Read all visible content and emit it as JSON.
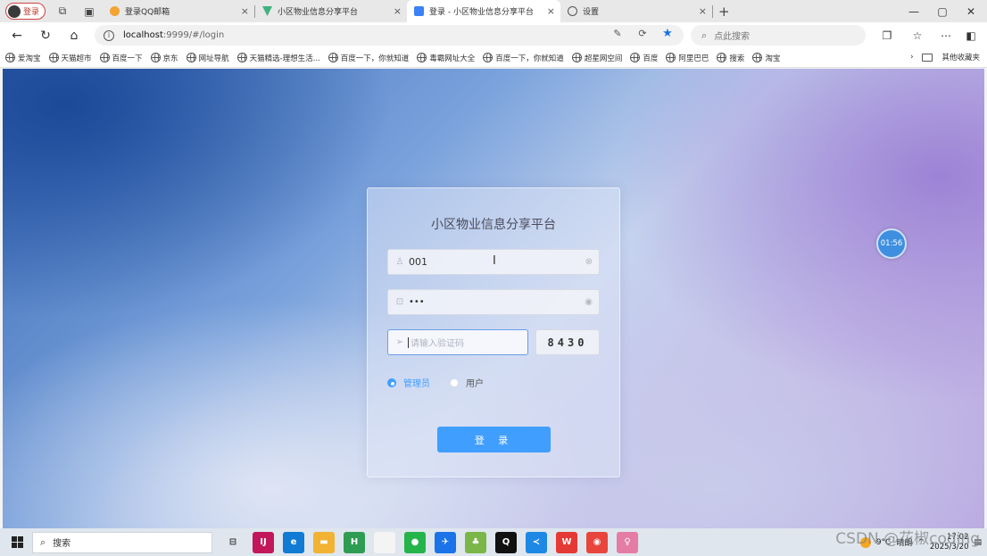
{
  "browser": {
    "profile_label": "登录",
    "tabs": [
      {
        "title": "登录QQ邮箱",
        "color": "#f2a533"
      },
      {
        "title": "小区物业信息分享平台",
        "color": "#3fb27f"
      },
      {
        "title": "登录 - 小区物业信息分享平台",
        "color": "#3c82f6"
      },
      {
        "title": "设置",
        "color": "#555555"
      }
    ],
    "address": {
      "host": "localhost",
      "rest": ":9999/#/login"
    },
    "search_placeholder": "点此搜索",
    "bookmarks": [
      "爱淘宝",
      "天猫超市",
      "百度一下",
      "京东",
      "网址导航",
      "天猫精选-理想生活...",
      "百度一下，你就知道",
      "毒霸网址大全",
      "百度一下，你就知道",
      "超星网空间",
      "百度",
      "阿里巴巴",
      "搜索",
      "淘宝"
    ],
    "other_bookmarks": "其他收藏夹"
  },
  "login": {
    "title": "小区物业信息分享平台",
    "username_value": "001",
    "password_value": "•••",
    "captcha_placeholder": "请输入验证码",
    "captcha_code": "8430",
    "roles": [
      {
        "label": "管理员",
        "selected": true
      },
      {
        "label": "用户",
        "selected": false
      }
    ],
    "submit_label": "登 录"
  },
  "timer_badge": "01:56",
  "taskbar": {
    "search_label": "搜索",
    "apps": [
      {
        "name": "task-view",
        "color": "#dfe6ee",
        "glyph": "⊟"
      },
      {
        "name": "idea",
        "color": "#c2185b",
        "glyph": "IJ"
      },
      {
        "name": "edge",
        "color": "#0f7bd4",
        "glyph": "e"
      },
      {
        "name": "explorer",
        "color": "#f2b233",
        "glyph": "▬"
      },
      {
        "name": "hbuilder",
        "color": "#2e9d53",
        "glyph": "H"
      },
      {
        "name": "notepad",
        "color": "#f4f4f4",
        "glyph": ""
      },
      {
        "name": "wechat",
        "color": "#25b44a",
        "glyph": "●"
      },
      {
        "name": "feishu",
        "color": "#1a73e8",
        "glyph": "✈"
      },
      {
        "name": "frog",
        "color": "#7ab648",
        "glyph": "♣"
      },
      {
        "name": "qq",
        "color": "#111111",
        "glyph": "Q"
      },
      {
        "name": "vscode",
        "color": "#1e88e5",
        "glyph": "≺"
      },
      {
        "name": "wps",
        "color": "#e53935",
        "glyph": "W"
      },
      {
        "name": "chrome",
        "color": "#e8453c",
        "glyph": "◉"
      },
      {
        "name": "user-app",
        "color": "#e57ca4",
        "glyph": "♀"
      }
    ],
    "weather": "9°C",
    "weather_text": "晴朗",
    "time": "17:02",
    "date": "2025/3/20"
  },
  "watermark": "CSDN @花椒coding"
}
